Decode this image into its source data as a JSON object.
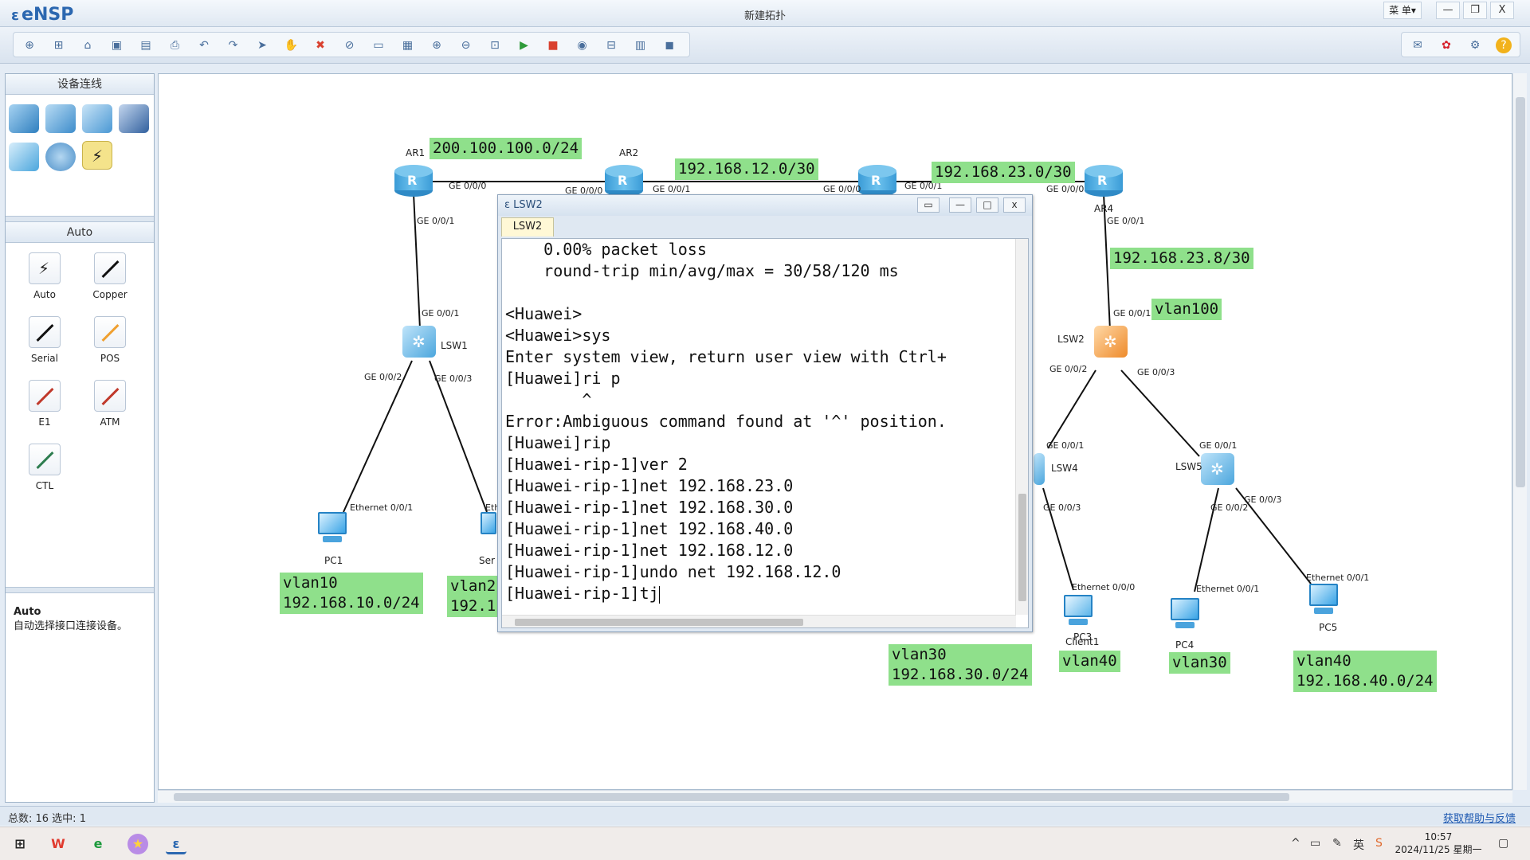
{
  "app": {
    "name": "eNSP",
    "window_title": "新建拓扑",
    "menu_label": "菜 单▾",
    "win_min": "—",
    "win_restore": "❐",
    "win_close": "X"
  },
  "toolbar": {
    "icons": [
      "new-topology-icon",
      "new-lab-icon",
      "open-icon",
      "save-icon",
      "save-as-icon",
      "print-icon",
      "undo-icon",
      "redo-icon",
      "select-icon",
      "pan-icon",
      "delete-icon",
      "delete-link-icon",
      "text-icon",
      "palette-icon",
      "zoom-in-icon",
      "zoom-out-icon",
      "fit-icon",
      "start-icon",
      "stop-icon",
      "capture-icon",
      "topology-icon",
      "grid-icon",
      "screenshot-icon"
    ],
    "right_icons": [
      "chat-icon",
      "huawei-icon",
      "settings-icon",
      "help-icon"
    ]
  },
  "left_panel": {
    "device_header": "设备连线",
    "auto_header": "Auto",
    "connections": [
      {
        "label": "Auto",
        "color": "#222222"
      },
      {
        "label": "Copper",
        "color": "#111111"
      },
      {
        "label": "Serial",
        "color": "#111111"
      },
      {
        "label": "POS",
        "color": "#f0a030"
      },
      {
        "label": "E1",
        "color": "#c0392b"
      },
      {
        "label": "ATM",
        "color": "#c0392b"
      },
      {
        "label": "CTL",
        "color": "#2e7d4f"
      }
    ],
    "info_title": "Auto",
    "info_desc": "自动选择接口连接设备。"
  },
  "topology": {
    "nodes": {
      "ar1": "AR1",
      "ar2": "AR2",
      "ar4": "AR4",
      "lsw1": "LSW1",
      "lsw2": "LSW2",
      "lsw4": "LSW4",
      "lsw5": "LSW5",
      "pc1": "PC1",
      "pc3": "PC3",
      "pc4": "PC4",
      "pc5": "PC5",
      "client1": "Client1",
      "server": "Ser"
    },
    "ports": {
      "ar1_g000": "GE 0/0/0",
      "ar2_g000": "GE 0/0/0",
      "ar2_g001": "GE 0/0/1",
      "ar3_g000": "GE 0/0/0",
      "ar3_g001": "GE 0/0/1",
      "ar4_g000": "GE 0/0/0",
      "ar1_g001": "GE 0/0/1",
      "lsw1_g001": "GE 0/0/1",
      "lsw1_g002": "GE 0/0/2",
      "lsw1_g003": "GE 0/0/3",
      "pc1_eth": "Ethernet 0/0/1",
      "srv_eth": "Eth",
      "ar4_g001": "GE 0/0/1",
      "lsw2_g001": "GE 0/0/1",
      "lsw2_g002": "GE 0/0/2",
      "lsw2_g003": "GE 0/0/3",
      "lsw4_g001": "GE 0/0/1",
      "lsw4_g003": "GE 0/0/3",
      "lsw5_g001": "GE 0/0/1",
      "lsw5_g002": "GE 0/0/2",
      "lsw5_g003": "GE 0/0/3",
      "client1_eth": "Ethernet 0/0/0",
      "pc4_eth": "Ethernet 0/0/1",
      "pc5_eth": "Ethernet 0/0/1"
    },
    "labels": {
      "net_ar1_ar2": "200.100.100.0/24",
      "net_ar2_ar3": "192.168.12.0/30",
      "net_ar3_ar4": "192.168.23.0/30",
      "net_ar4_lsw2": "192.168.23.8/30",
      "vlan100": "vlan100",
      "pc1_vlan": "vlan10\n192.168.10.0/24",
      "srv_vlan": "vlan2\n192.1",
      "pc3_vlan": "vlan30\n192.168.30.0/24",
      "client1_vlan": "vlan40",
      "pc4_vlan": "vlan30",
      "pc5_vlan": "vlan40\n192.168.40.0/24"
    }
  },
  "terminal": {
    "title": "LSW2",
    "tab": "LSW2",
    "lines": [
      "    0.00% packet loss",
      "    round-trip min/avg/max = 30/58/120 ms",
      "",
      "<Huawei>",
      "<Huawei>sys",
      "Enter system view, return user view with Ctrl+",
      "[Huawei]ri p",
      "        ^",
      "Error:Ambiguous command found at '^' position.",
      "[Huawei]rip",
      "[Huawei-rip-1]ver 2",
      "[Huawei-rip-1]net 192.168.23.0",
      "[Huawei-rip-1]net 192.168.30.0",
      "[Huawei-rip-1]net 192.168.40.0",
      "[Huawei-rip-1]net 192.168.12.0",
      "[Huawei-rip-1]undo net 192.168.12.0"
    ],
    "prompt_line": "[Huawei-rip-1]tj"
  },
  "status": {
    "left": "总数: 16 选中: 1",
    "link": "获取帮助与反馈"
  },
  "taskbar": {
    "time": "10:57",
    "date": "2024/11/25 星期一",
    "ime": "英"
  }
}
